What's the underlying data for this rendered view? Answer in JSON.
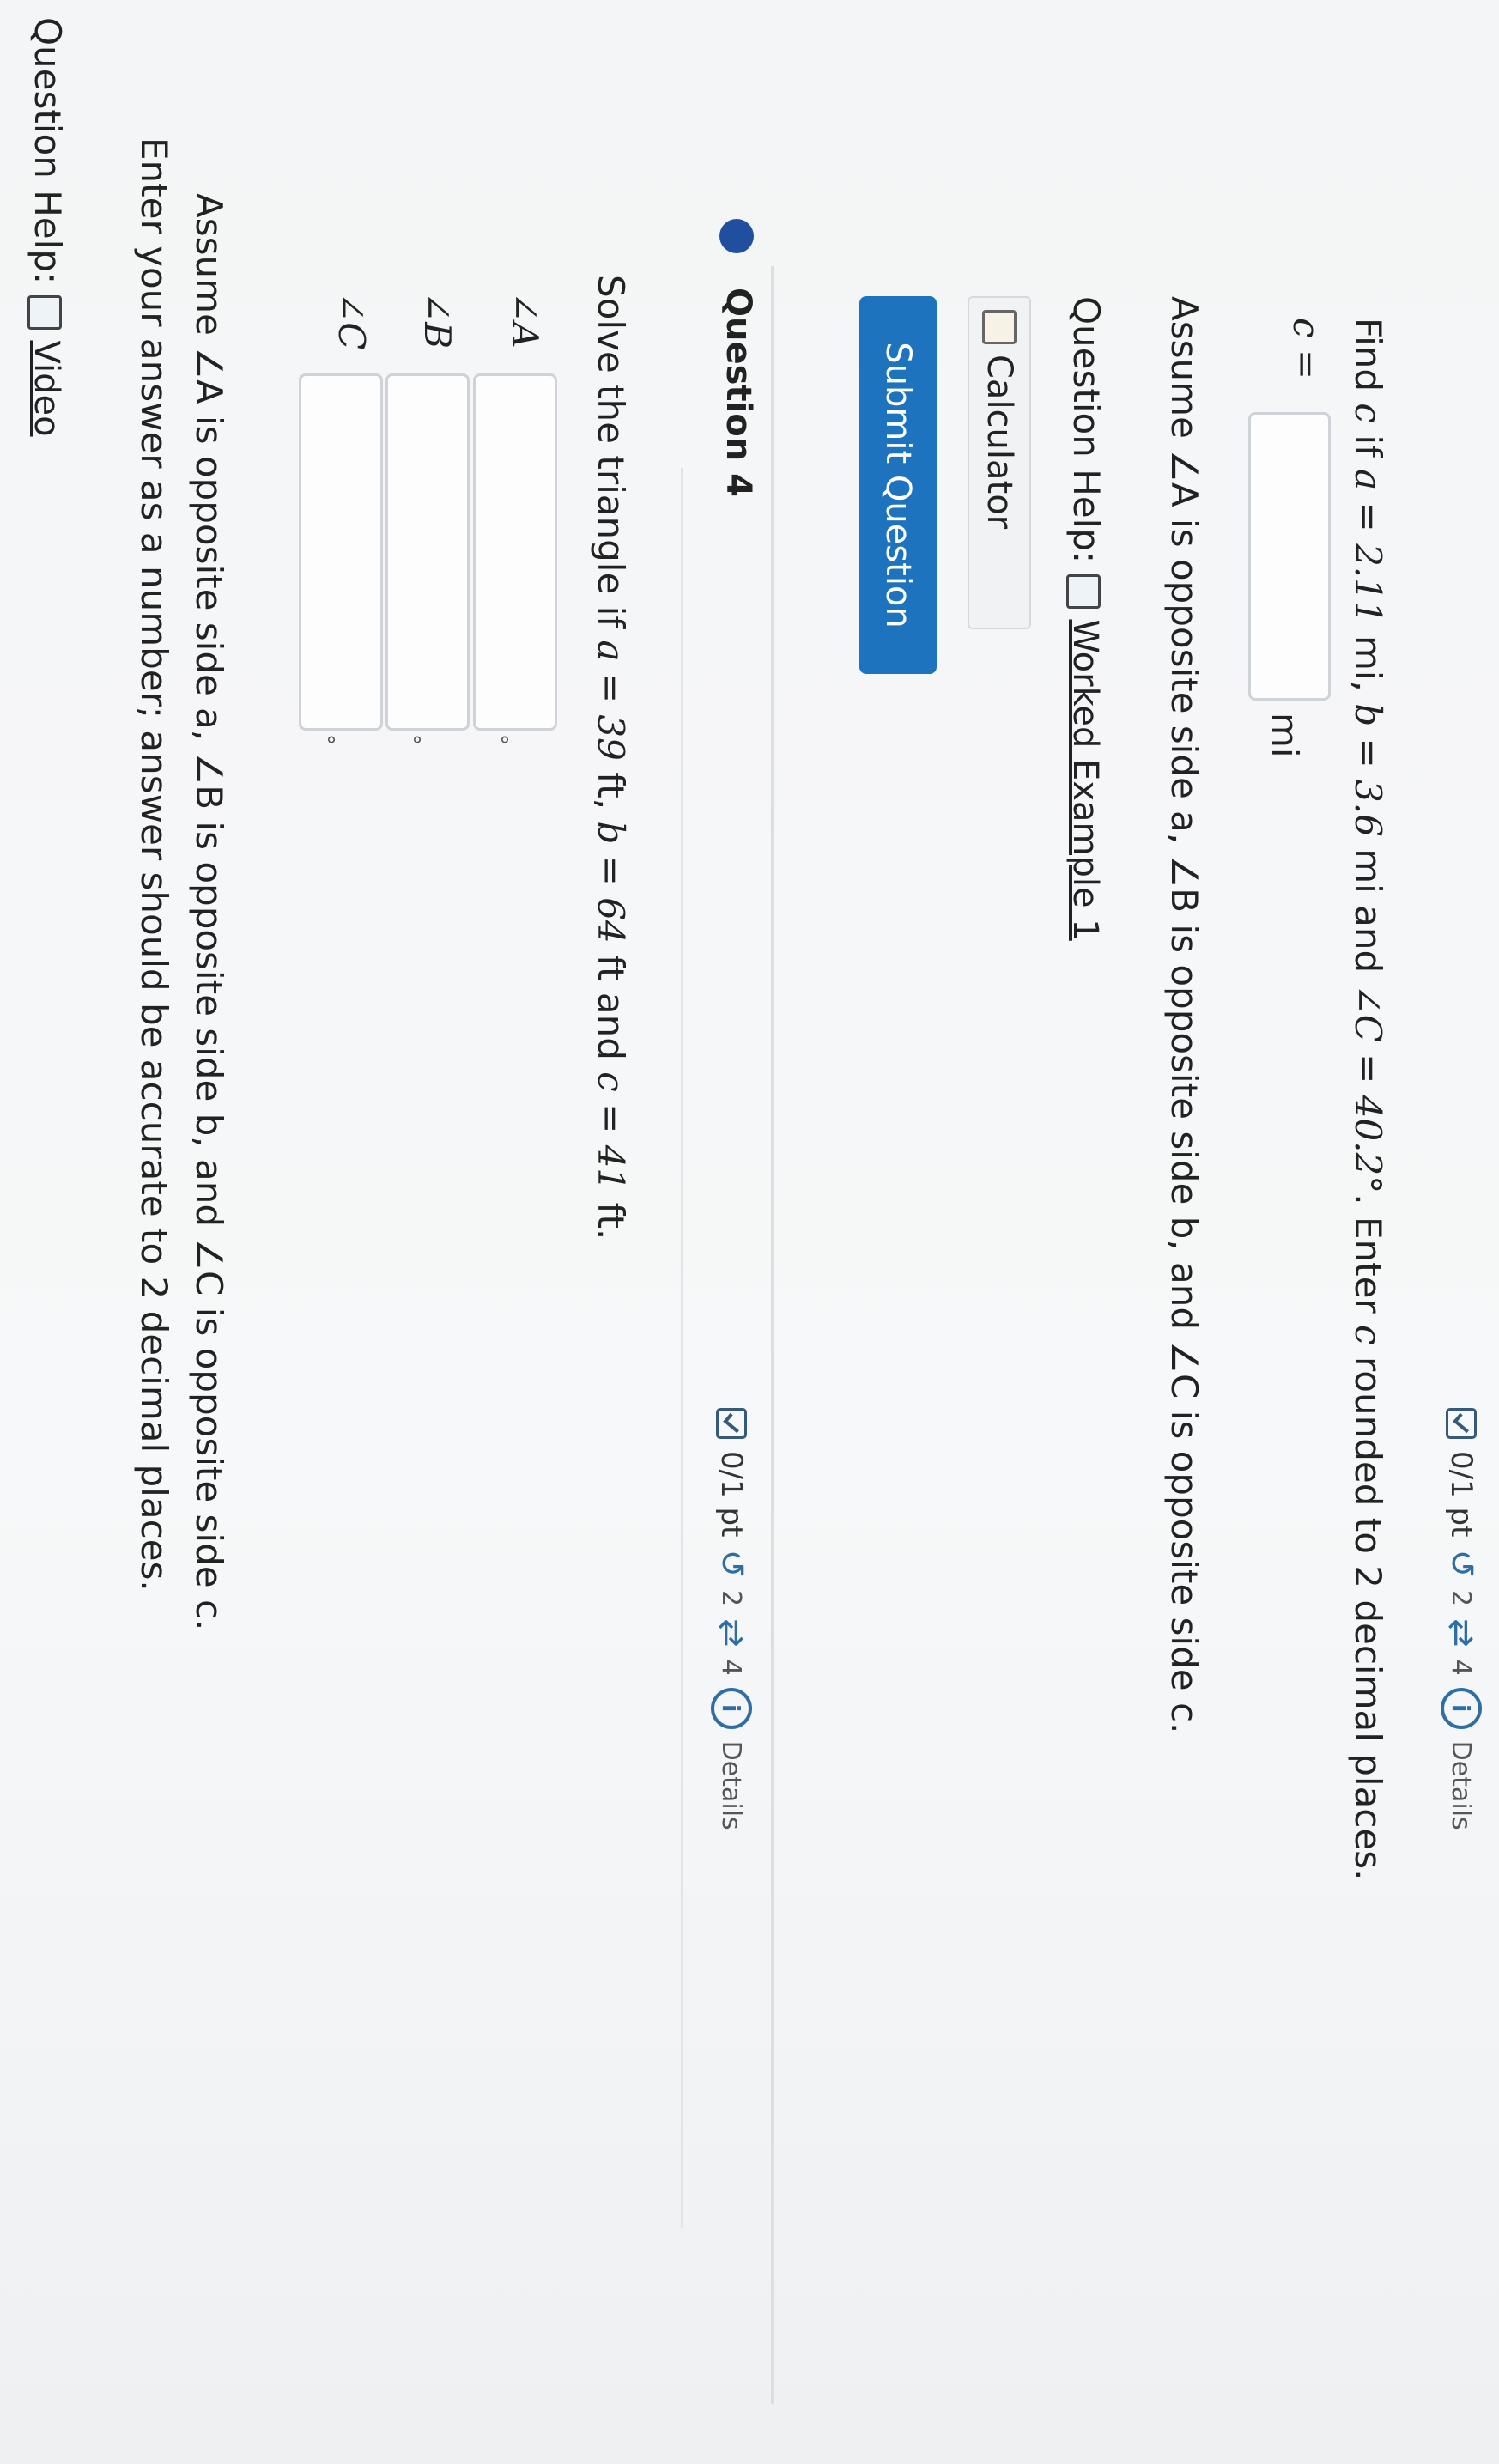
{
  "question3": {
    "points": "0/1 pt",
    "retries": "2",
    "attempts": "4",
    "details": "Details",
    "prompt_find": "Find",
    "prompt_var_c": "c",
    "prompt_if": "if",
    "a_expr": "a = 2.11",
    "a_unit": "mi,",
    "b_expr": "b = 3.6",
    "b_unit": "mi and",
    "angle_expr": "∠C = 40.2°",
    "prompt_tail": ". Enter",
    "prompt_var_c2": "c",
    "prompt_end": "rounded to 2 decimal places.",
    "answer_label": "c =",
    "answer_unit": "mi",
    "assume_text": "Assume ∠A is opposite side a, ∠B is opposite side b, and ∠C is opposite side c.",
    "help_label": "Question Help:",
    "help_link": "Worked Example 1",
    "calculator_label": "Calculator",
    "submit_label": "Submit Question"
  },
  "question4": {
    "title": "Question 4",
    "points": "0/1 pt",
    "retries": "2",
    "attempts": "4",
    "details": "Details",
    "solve_text": "Solve the triangle if",
    "a_expr": "a = 39",
    "a_unit": "ft,",
    "b_expr": "b = 64",
    "b_unit": "ft and",
    "c_expr": "c = 41",
    "c_unit": "ft.",
    "angle_a": "∠A",
    "angle_b": "∠B",
    "angle_c": "∠C",
    "degree": "°",
    "assume_text": "Assume ∠A is opposite side a, ∠B is opposite side b, and ∠C is opposite side c.",
    "enter_text": "Enter your answer as a number; answer should be accurate to 2 decimal places.",
    "help_label": "Question Help:",
    "help_link": "Video"
  },
  "colors": {
    "accent": "#1e73be",
    "question_dot": "#1f4f9e",
    "icon_blue": "#2f6ea5"
  },
  "icons": [
    "checkbox-icon",
    "retry-icon",
    "attempts-icon",
    "info-icon",
    "worked-example-icon",
    "calculator-icon",
    "video-icon"
  ]
}
